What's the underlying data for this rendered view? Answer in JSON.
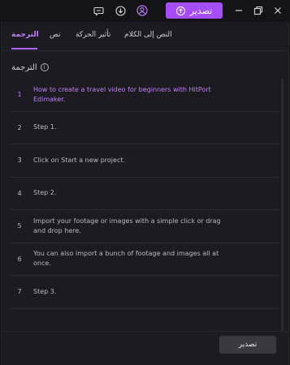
{
  "titlebar": {
    "export_label": "تصدير",
    "icons": [
      "feedback-icon",
      "download-icon",
      "account-icon",
      "minimize-icon",
      "restore-icon",
      "close-icon"
    ]
  },
  "tabs": [
    {
      "label": "النص إلى الكلام",
      "active": false
    },
    {
      "label": "تأثير الحركة",
      "active": false
    },
    {
      "label": "نص",
      "active": false
    },
    {
      "label": "الترجمة",
      "active": true
    }
  ],
  "section": {
    "title": "الترجمة",
    "info_icon": "info-icon"
  },
  "rows": [
    {
      "index": "1",
      "text": "How to create a travel video for beginners with HitPort Edimaker.",
      "highlight": true
    },
    {
      "index": "2",
      "text": "Step 1.",
      "highlight": false
    },
    {
      "index": "3",
      "text": "Click on Start a new project.",
      "highlight": false
    },
    {
      "index": "4",
      "text": "Step 2.",
      "highlight": false
    },
    {
      "index": "5",
      "text": "Import your footage or images with a simple click or drag and drop here.",
      "highlight": false
    },
    {
      "index": "6",
      "text": "You can also import a bunch of footage and images all at once.",
      "highlight": false
    },
    {
      "index": "7",
      "text": "Step 3.",
      "highlight": false
    }
  ],
  "footer": {
    "export_label": "تصدير"
  },
  "colors": {
    "accent": "#a64dfa",
    "accent_text": "#c27ef8",
    "background": "#1c1b21"
  }
}
